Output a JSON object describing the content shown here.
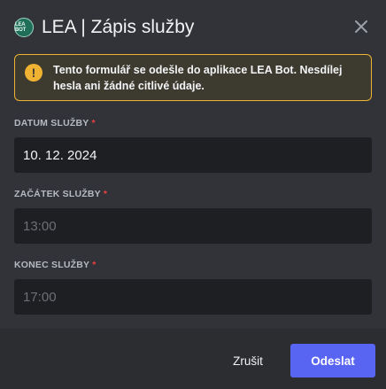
{
  "modal": {
    "logo_text": "LEA BOT",
    "title": "LEA | Zápis služby",
    "close_icon": "close-icon"
  },
  "notice": {
    "icon": "warning-icon",
    "text": "Tento formulář se odešle do aplikace LEA Bot. Nesdílej hesla ani žádné citlivé údaje."
  },
  "fields": [
    {
      "label": "DATUM SLUŽBY",
      "required_mark": "*",
      "value": "10. 12. 2024",
      "placeholder": ""
    },
    {
      "label": "ZAČÁTEK SLUŽBY",
      "required_mark": "*",
      "value": "",
      "placeholder": "13:00"
    },
    {
      "label": "KONEC SLUŽBY",
      "required_mark": "*",
      "value": "",
      "placeholder": "17:00"
    }
  ],
  "footer": {
    "cancel_label": "Zrušit",
    "submit_label": "Odeslat"
  },
  "colors": {
    "background": "#313338",
    "footer": "#2b2d31",
    "input": "#1e1f22",
    "warning": "#f0b232",
    "required": "#f23f43",
    "primary": "#5865f2"
  }
}
